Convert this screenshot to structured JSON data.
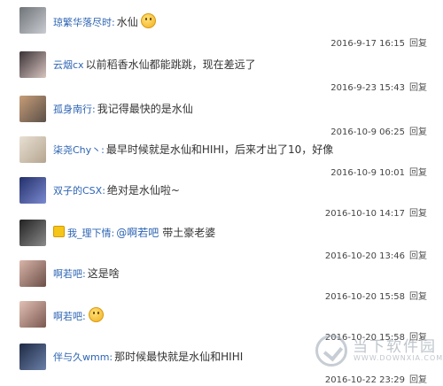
{
  "comments": [
    {
      "user": "琼繁华落尽时:",
      "text": "水仙",
      "emoji": true,
      "date": "2016-9-17 16:15",
      "reply": "回复",
      "avatar": [
        "#6f7478",
        "#c9ccd0"
      ]
    },
    {
      "user": "云烟cx",
      "text": "以前稻香水仙都能跳跳，现在差远了",
      "emoji": false,
      "date": "2016-9-23 15:43",
      "reply": "回复",
      "avatar": [
        "#3a3236",
        "#d8c4c0"
      ]
    },
    {
      "user": "孤身南行:",
      "text": "我记得最快的是水仙",
      "emoji": false,
      "date": "2016-10-9 06:25",
      "reply": "回复",
      "avatar": [
        "#c79d78",
        "#5b5048"
      ]
    },
    {
      "user": "柒尧Chy丶:",
      "text": "最早时候就是水仙和HIHI，后来才出了10，好像",
      "emoji": false,
      "date": "2016-10-9 10:01",
      "reply": "回复",
      "avatar": [
        "#e8e0d4",
        "#b5a58f"
      ]
    },
    {
      "user": "双子的CSX:",
      "text": "绝对是水仙啦~",
      "emoji": false,
      "date": "2016-10-10 14:17",
      "reply": "回复",
      "avatar": [
        "#23306b",
        "#7b8ad0"
      ]
    },
    {
      "user": "我_理下情:",
      "mention": "@啊若吧",
      "text": "带土豪老婆",
      "emoji": false,
      "badge": true,
      "date": "2016-10-20 13:46",
      "reply": "回复",
      "avatar": [
        "#222222",
        "#8a8a8a"
      ]
    },
    {
      "user": "啊若吧:",
      "text": "这是啥",
      "emoji": false,
      "date": "2016-10-20 15:58",
      "reply": "回复",
      "avatar": [
        "#d9b4a8",
        "#6b4f48"
      ]
    },
    {
      "user": "啊若吧:",
      "text": "",
      "emoji": true,
      "date": "2016-10-20 15:58",
      "reply": "回复",
      "avatar": [
        "#e2c0b4",
        "#7a5850"
      ]
    },
    {
      "user": "伴与久wmm:",
      "text": "那时候最快就是水仙和HIHI",
      "emoji": false,
      "date": "2016-10-22 23:29",
      "reply": "回复",
      "avatar": [
        "#1e2a44",
        "#6a7fa8"
      ]
    }
  ],
  "watermark": {
    "cn": "当下软件园",
    "en": "WWW.DOWNXIA.COM"
  }
}
